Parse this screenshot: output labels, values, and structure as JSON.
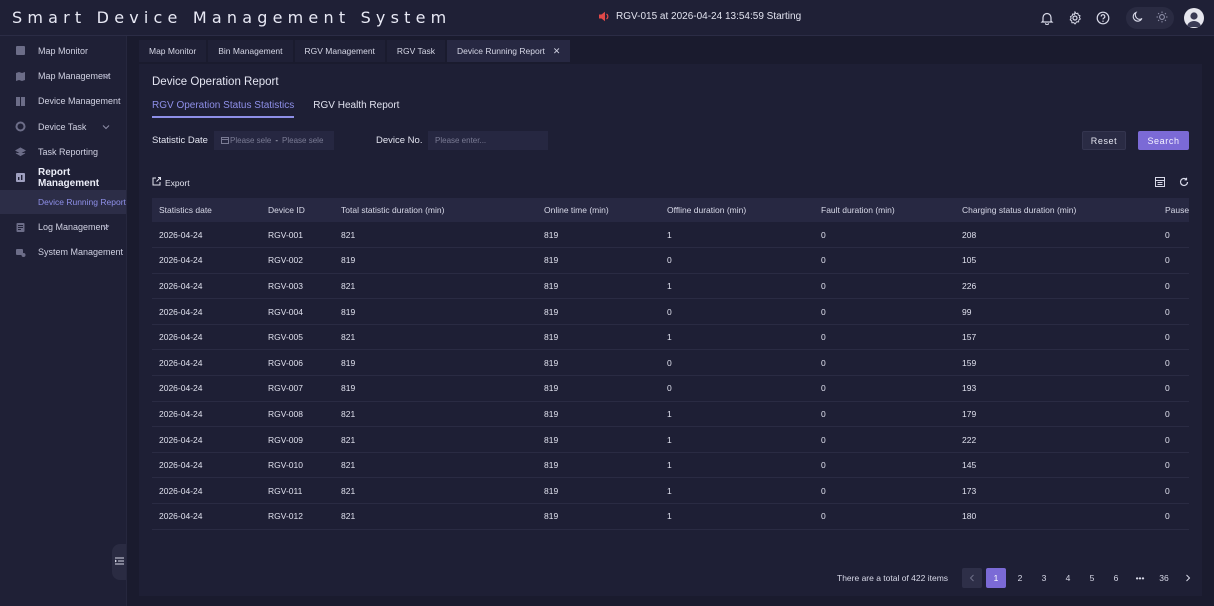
{
  "header": {
    "title": "Smart Device Management System",
    "alarm_text": "RGV-015 at 2026-04-24 13:54:59 Starting",
    "colors": {
      "accent": "#7b6ad6",
      "alarm": "#e04848"
    }
  },
  "sidebar": {
    "items": [
      {
        "label": "Map Monitor",
        "icon": "monitor-icon"
      },
      {
        "label": "Map Management",
        "icon": "map-icon",
        "expandable": true
      },
      {
        "label": "Device Management",
        "icon": "device-icon"
      },
      {
        "label": "Device Task",
        "icon": "task-icon",
        "expandable": true
      },
      {
        "label": "Task Reporting",
        "icon": "layers-icon"
      },
      {
        "label": "Report Management",
        "icon": "report-icon",
        "expanded": true
      },
      {
        "label": "Log Management",
        "icon": "log-icon",
        "expandable": true
      },
      {
        "label": "System Management",
        "icon": "system-icon"
      }
    ],
    "active_sub": "Device Running Report"
  },
  "tabs": [
    "Map Monitor",
    "Bin Management",
    "RGV Management",
    "RGV Task",
    "Device Running Report"
  ],
  "panel": {
    "title": "Device Operation Report",
    "sub_tabs": [
      "RGV Operation Status Statistics",
      "RGV Health Report"
    ]
  },
  "filter": {
    "date_label": "Statistic Date",
    "start_placeholder": "Please sele",
    "end_placeholder": "Please sele",
    "device_label": "Device No.",
    "device_placeholder": "Please enter...",
    "reset": "Reset",
    "search": "Search"
  },
  "toolbar": {
    "export": "Export"
  },
  "table": {
    "columns": [
      "Statistics date",
      "Device ID",
      "Total statistic duration (min)",
      "Online time (min)",
      "Offline duration (min)",
      "Fault duration (min)",
      "Charging status duration (min)",
      "Pause"
    ],
    "rows": [
      [
        "2026-04-24",
        "RGV-001",
        "821",
        "819",
        "1",
        "0",
        "208",
        "0"
      ],
      [
        "2026-04-24",
        "RGV-002",
        "819",
        "819",
        "0",
        "0",
        "105",
        "0"
      ],
      [
        "2026-04-24",
        "RGV-003",
        "821",
        "819",
        "1",
        "0",
        "226",
        "0"
      ],
      [
        "2026-04-24",
        "RGV-004",
        "819",
        "819",
        "0",
        "0",
        "99",
        "0"
      ],
      [
        "2026-04-24",
        "RGV-005",
        "821",
        "819",
        "1",
        "0",
        "157",
        "0"
      ],
      [
        "2026-04-24",
        "RGV-006",
        "819",
        "819",
        "0",
        "0",
        "159",
        "0"
      ],
      [
        "2026-04-24",
        "RGV-007",
        "819",
        "819",
        "0",
        "0",
        "193",
        "0"
      ],
      [
        "2026-04-24",
        "RGV-008",
        "821",
        "819",
        "1",
        "0",
        "179",
        "0"
      ],
      [
        "2026-04-24",
        "RGV-009",
        "821",
        "819",
        "1",
        "0",
        "222",
        "0"
      ],
      [
        "2026-04-24",
        "RGV-010",
        "821",
        "819",
        "1",
        "0",
        "145",
        "0"
      ],
      [
        "2026-04-24",
        "RGV-011",
        "821",
        "819",
        "1",
        "0",
        "173",
        "0"
      ],
      [
        "2026-04-24",
        "RGV-012",
        "821",
        "819",
        "1",
        "0",
        "180",
        "0"
      ]
    ]
  },
  "pagination": {
    "total_text": "There are a total of 422 items",
    "pages": [
      "1",
      "2",
      "3",
      "4",
      "5",
      "6",
      "•••",
      "36"
    ],
    "current": "1"
  }
}
